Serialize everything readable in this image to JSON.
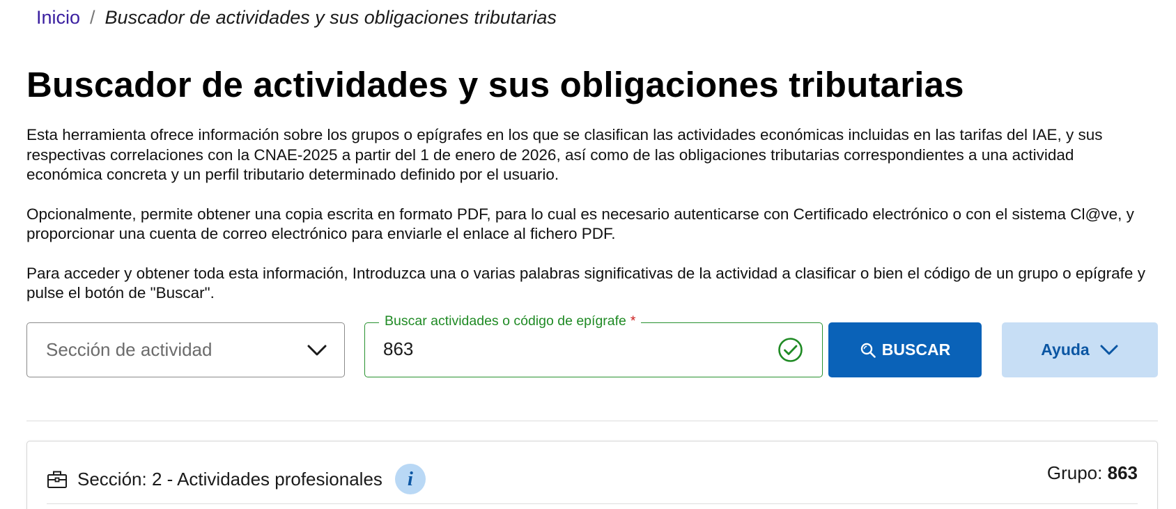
{
  "breadcrumb": {
    "home": "Inicio",
    "separator": "/",
    "current": "Buscador de actividades y sus obligaciones tributarias"
  },
  "page": {
    "title": "Buscador de actividades y sus obligaciones tributarias",
    "paragraphs": [
      "Esta herramienta ofrece información sobre los grupos o epígrafes en los que se clasifican las actividades económicas incluidas en las tarifas del IAE, y sus respectivas correlaciones con la CNAE-2025 a partir del 1 de enero de 2026, así como de las obligaciones tributarias correspondientes a una actividad económica concreta y un perfil tributario determinado definido por el usuario.",
      "Opcionalmente, permite obtener una copia escrita en formato PDF, para lo cual es necesario autenticarse con Certificado electrónico o con el sistema Cl@ve, y proporcionar una cuenta de correo electrónico para enviarle el enlace al fichero PDF.",
      "Para acceder y obtener toda esta información, Introduzca una o varias palabras significativas de la actividad a clasificar o bien el código de un grupo o epígrafe y pulse el botón de \"Buscar\"."
    ]
  },
  "form": {
    "section_select": {
      "placeholder": "Sección de actividad",
      "icon": "chevron-down-icon"
    },
    "search": {
      "label": "Buscar actividades o código de epígrafe",
      "required_mark": "*",
      "value": "863",
      "valid_icon": "check-circle-icon"
    },
    "buscar_button": {
      "label": "BUSCAR",
      "icon": "search-icon"
    },
    "ayuda_button": {
      "label": "Ayuda",
      "icon": "chevron-down-icon"
    }
  },
  "result": {
    "section_icon": "briefcase-icon",
    "section_label": "Sección: 2 - Actividades profesionales",
    "info_icon": "info-icon",
    "info_glyph": "i",
    "group_label": "Grupo:",
    "group_value": "863"
  },
  "colors": {
    "link": "#3a1fa0",
    "primary_button": "#0a62b8",
    "secondary_button": "#c7def5",
    "secondary_button_text": "#0b56a3",
    "valid_green": "#1f8a24",
    "required_red": "#cc1f1f"
  }
}
